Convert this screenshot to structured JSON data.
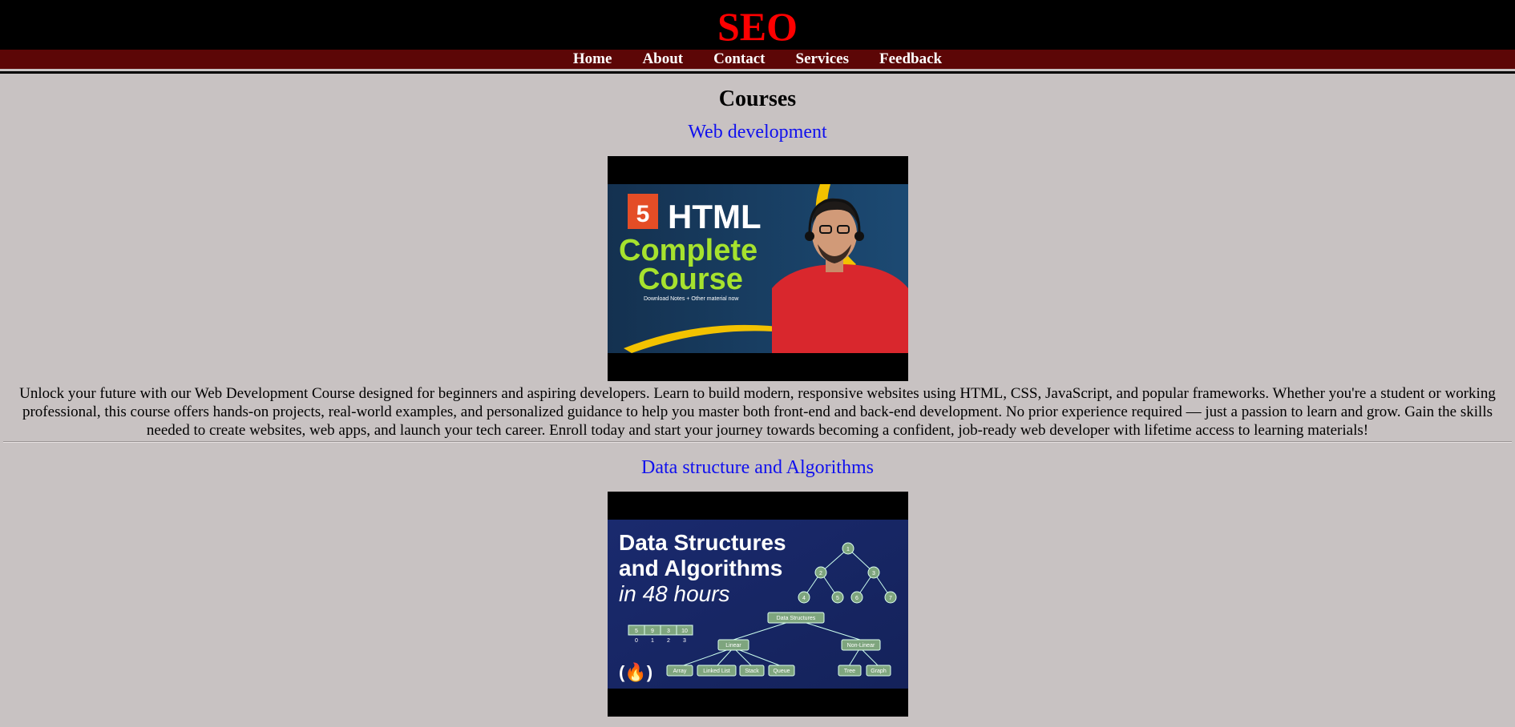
{
  "site": {
    "brand": "SEO"
  },
  "nav": {
    "items": [
      {
        "label": "Home"
      },
      {
        "label": "About"
      },
      {
        "label": "Contact"
      },
      {
        "label": "Services"
      },
      {
        "label": "Feedback"
      }
    ]
  },
  "main": {
    "title": "Courses",
    "courses": [
      {
        "title": "Web development",
        "thumb": {
          "badge": "5",
          "line1": "HTML",
          "line2": "Complete",
          "line3": "Course",
          "subtext": "Download Notes + Other material now"
        },
        "description": "Unlock your future with our Web Development Course designed for beginners and aspiring developers. Learn to build modern, responsive websites using HTML, CSS, JavaScript, and popular frameworks. Whether you're a student or working professional, this course offers hands-on projects, real-world examples, and personalized guidance to help you master both front-end and back-end development. No prior experience required — just a passion to learn and grow. Gain the skills needed to create websites, web apps, and launch your tech career. Enroll today and start your journey towards becoming a confident, job-ready web developer with lifetime access to learning materials!"
      },
      {
        "title": "Data structure and Algorithms",
        "thumb": {
          "line1": "Data Structures",
          "line2": "and Algorithms",
          "line3": "in 48 hours",
          "root": "Data Structures",
          "linear": "Linear",
          "nonlinear": "Non-Linear",
          "leaves": [
            "Array",
            "Linked List",
            "Stack",
            "Queue",
            "Tree",
            "Graph"
          ],
          "tree_nodes": [
            "1",
            "2",
            "3",
            "4",
            "5",
            "6",
            "7"
          ],
          "array_vals": [
            "5",
            "9",
            "3",
            "10"
          ],
          "array_idx": [
            "0",
            "1",
            "2",
            "3"
          ],
          "logo": "(🔥)"
        }
      }
    ]
  },
  "colors": {
    "background": "#c8c2c2",
    "brand": "#ff0000",
    "nav": "#5c0606",
    "course_title": "#1010ee"
  }
}
